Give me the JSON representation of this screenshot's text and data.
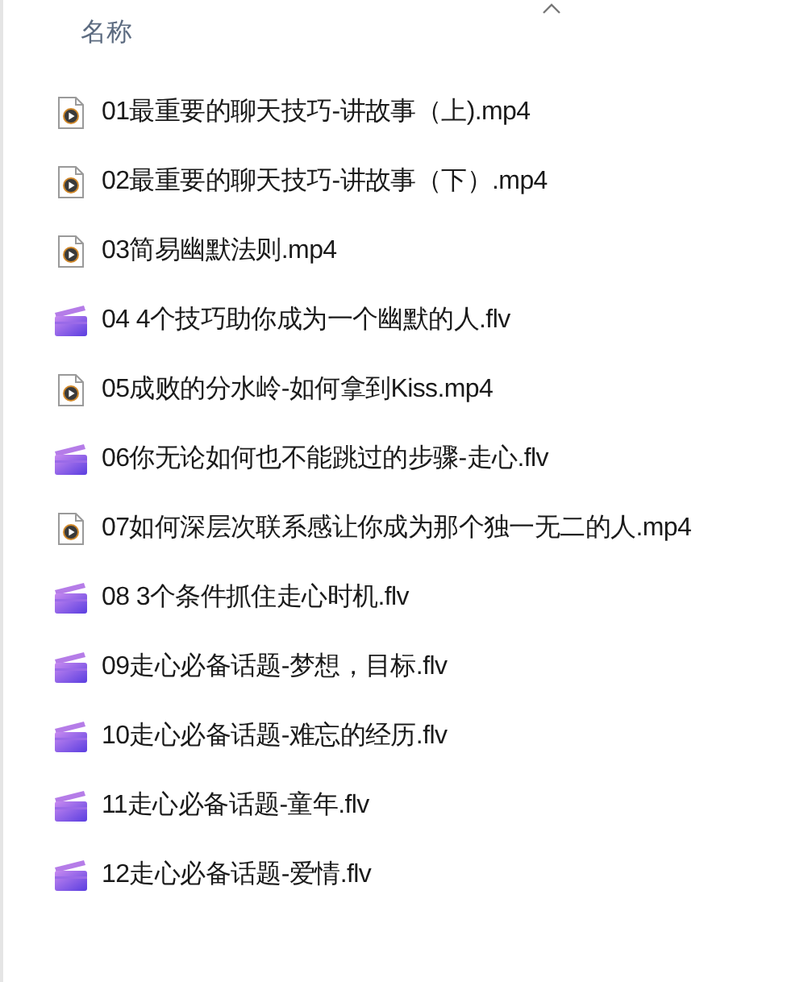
{
  "header": {
    "label": "名称"
  },
  "files": [
    {
      "name": "01最重要的聊天技巧-讲故事（上).mp4",
      "kind": "media"
    },
    {
      "name": "02最重要的聊天技巧-讲故事（下）.mp4",
      "kind": "media"
    },
    {
      "name": "03简易幽默法则.mp4",
      "kind": "media"
    },
    {
      "name": "04 4个技巧助你成为一个幽默的人.flv",
      "kind": "clip"
    },
    {
      "name": "05成败的分水岭-如何拿到Kiss.mp4",
      "kind": "media"
    },
    {
      "name": "06你无论如何也不能跳过的步骤-走心.flv",
      "kind": "clip"
    },
    {
      "name": "07如何深层次联系感让你成为那个独一无二的人.mp4",
      "kind": "media"
    },
    {
      "name": "08 3个条件抓住走心时机.flv",
      "kind": "clip"
    },
    {
      "name": "09走心必备话题-梦想，目标.flv",
      "kind": "clip"
    },
    {
      "name": "10走心必备话题-难忘的经历.flv",
      "kind": "clip"
    },
    {
      "name": "11走心必备话题-童年.flv",
      "kind": "clip"
    },
    {
      "name": "12走心必备话题-爱情.flv",
      "kind": "clip"
    }
  ]
}
